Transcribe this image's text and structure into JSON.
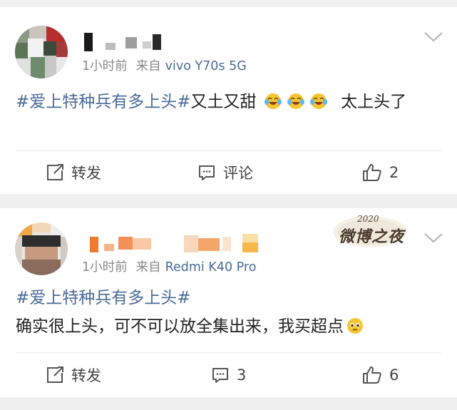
{
  "posts": [
    {
      "time": "1小时前",
      "source_label": "来自",
      "device": "vivo Y70s 5G",
      "hashtag": "#爱上特种兵有多上头#",
      "text_after_tag": "又土又甜",
      "emoji_count": 3,
      "text_trailing": "太上头了",
      "actions": {
        "repost": "转发",
        "comment": "评论",
        "like": "2"
      }
    },
    {
      "time": "1小时前",
      "source_label": "来自",
      "device": "Redmi K40 Pro",
      "hashtag": "#爱上特种兵有多上头#",
      "body": "确实很上头，可不可以放全集出来，我买超点",
      "badge_year": "2020",
      "badge_text": "微博之夜",
      "actions": {
        "repost": "转发",
        "comment": "3",
        "like": "6"
      }
    }
  ],
  "colors": {
    "link": "#4a6b98",
    "meta": "#8a8a8a",
    "background": "#f0f0f0"
  },
  "icons": [
    "avatar",
    "chevron-down-icon",
    "laughing-crying-emoji",
    "pleading-emoji",
    "repost-icon",
    "comment-icon",
    "like-icon",
    "weibo-night-badge"
  ]
}
